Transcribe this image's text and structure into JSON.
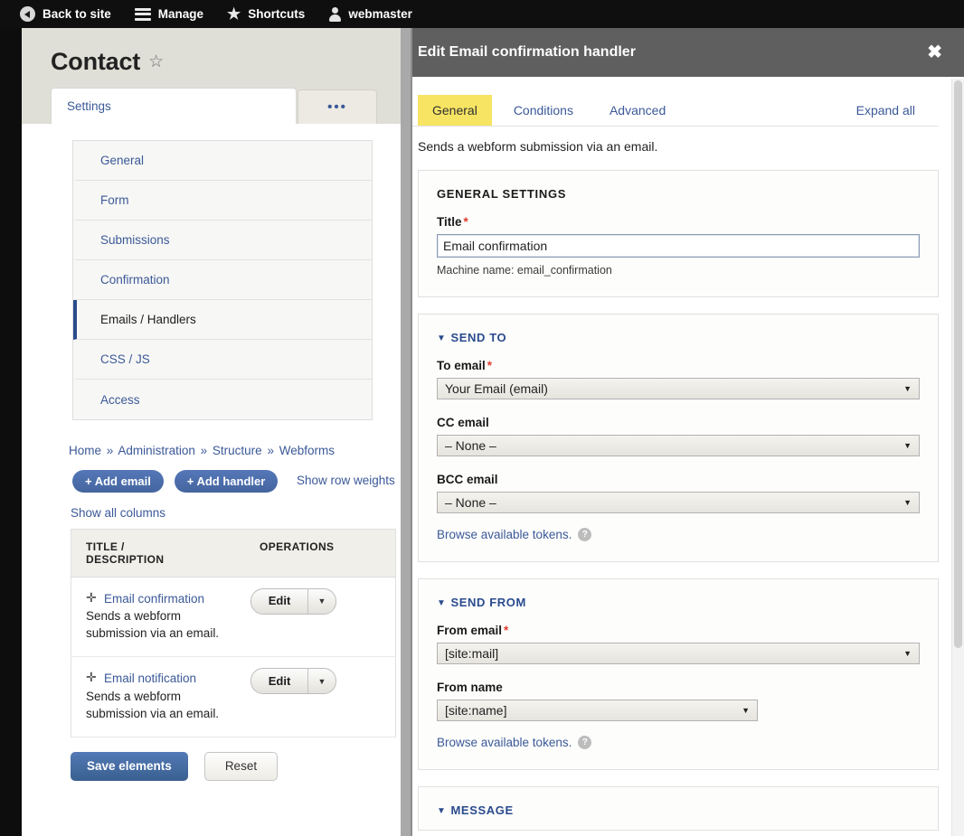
{
  "toolbar": {
    "items": [
      {
        "icon": "back-arrow-icon",
        "label": "Back to site"
      },
      {
        "icon": "hamburger-icon",
        "label": "Manage"
      },
      {
        "icon": "star-icon",
        "label": "Shortcuts"
      },
      {
        "icon": "user-icon",
        "label": "webmaster"
      }
    ]
  },
  "page": {
    "title": "Contact",
    "star_glyph": "☆",
    "tabs": [
      {
        "label": "Settings",
        "active": true
      },
      {
        "label": "•••",
        "active": false
      }
    ],
    "settings_nav": [
      {
        "label": "General",
        "active": false
      },
      {
        "label": "Form",
        "active": false
      },
      {
        "label": "Submissions",
        "active": false
      },
      {
        "label": "Confirmation",
        "active": false
      },
      {
        "label": "Emails / Handlers",
        "active": true
      },
      {
        "label": "CSS / JS",
        "active": false
      },
      {
        "label": "Access",
        "active": false
      }
    ],
    "breadcrumb": [
      "Home",
      "Administration",
      "Structure",
      "Webforms"
    ],
    "breadcrumb_separator": "»",
    "add_email_label": "+ Add email",
    "add_handler_label": "+ Add handler",
    "show_row_weights_label": "Show row weights",
    "show_all_columns_label": "Show all columns",
    "table": {
      "columns": [
        "TITLE / DESCRIPTION",
        "OPERATIONS"
      ],
      "column_title_line1": "TITLE /",
      "column_title_line2": "DESCRIPTION",
      "rows": [
        {
          "drag_glyph": "✛",
          "title": "Email confirmation",
          "description": "Sends a webform submission via an email.",
          "operation_label": "Edit",
          "operation_caret": "▼"
        },
        {
          "drag_glyph": "✛",
          "title": "Email notification",
          "description": "Sends a webform submission via an email.",
          "operation_label": "Edit",
          "operation_caret": "▼"
        }
      ]
    },
    "save_button_label": "Save elements",
    "reset_button_label": "Reset"
  },
  "dialog": {
    "title": "Edit Email confirmation handler",
    "close_glyph": "✖",
    "tabs": [
      {
        "label": "General",
        "active": true
      },
      {
        "label": "Conditions",
        "active": false
      },
      {
        "label": "Advanced",
        "active": false
      }
    ],
    "expand_all_label": "Expand all",
    "intro": "Sends a webform submission via an email.",
    "general_settings": {
      "legend": "General settings",
      "title_label": "Title",
      "title_value": "Email confirmation",
      "title_required": "*",
      "machine_name": "Machine name: email_confirmation"
    },
    "send_to": {
      "legend": "Send to",
      "triangle": "▼",
      "fields": [
        {
          "label": "To email",
          "required": "*",
          "value": "Your Email (email)",
          "width": "full"
        },
        {
          "label": "CC email",
          "required": "",
          "value": "– None –",
          "width": "full"
        },
        {
          "label": "BCC email",
          "required": "",
          "value": "– None –",
          "width": "full"
        }
      ],
      "tokens_label": "Browse available tokens.",
      "help_glyph": "?"
    },
    "send_from": {
      "legend": "Send from",
      "triangle": "▼",
      "fields": [
        {
          "label": "From email",
          "required": "*",
          "value": "[site:mail]",
          "width": "full"
        },
        {
          "label": "From name",
          "required": "",
          "value": "[site:name]",
          "width": "sub"
        }
      ],
      "tokens_label": "Browse available tokens.",
      "help_glyph": "?"
    },
    "message": {
      "legend": "Message",
      "triangle": "▼"
    },
    "select_arrow": "▼"
  },
  "colors": {
    "toolbar_bg": "#0f0f0f",
    "page_header_bg": "#dfdfd7",
    "link_blue": "#3b5998",
    "active_nav_border": "#2a4b8d",
    "dialog_header_bg": "#5f5f5f",
    "active_tab_yellow": "#f7e463",
    "required_red": "#e03c2c",
    "button_blue": "#44659f"
  }
}
